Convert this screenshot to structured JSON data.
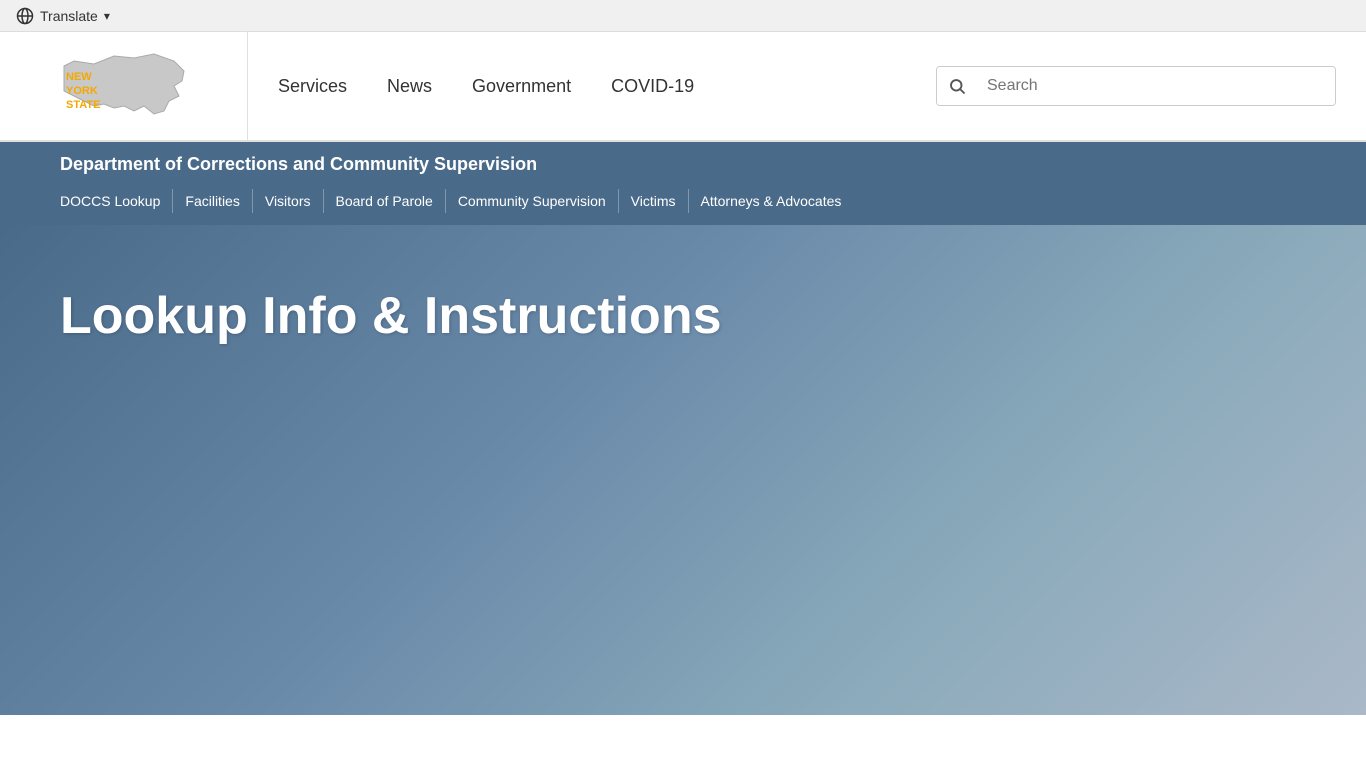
{
  "translate_bar": {
    "translate_label": "Translate",
    "globe_symbol": "🌐",
    "chevron_symbol": "▾"
  },
  "header": {
    "logo": {
      "state_name_line1": "NEW",
      "state_name_line2": "YORK",
      "state_name_line3": "STATE",
      "alt": "New York State Logo"
    },
    "nav": {
      "items": [
        {
          "label": "Services",
          "id": "services"
        },
        {
          "label": "News",
          "id": "news"
        },
        {
          "label": "Government",
          "id": "government"
        },
        {
          "label": "COVID-19",
          "id": "covid"
        }
      ]
    },
    "search": {
      "placeholder": "Search"
    }
  },
  "dept_bar": {
    "title": "Department of Corrections and Community Supervision",
    "nav_items": [
      {
        "label": "DOCCS Lookup",
        "id": "doccs-lookup"
      },
      {
        "label": "Facilities",
        "id": "facilities"
      },
      {
        "label": "Visitors",
        "id": "visitors"
      },
      {
        "label": "Board of Parole",
        "id": "board-of-parole"
      },
      {
        "label": "Community Supervision",
        "id": "community-supervision"
      },
      {
        "label": "Victims",
        "id": "victims"
      },
      {
        "label": "Attorneys & Advocates",
        "id": "attorneys-advocates"
      }
    ]
  },
  "hero": {
    "title": "Lookup Info & Instructions"
  }
}
